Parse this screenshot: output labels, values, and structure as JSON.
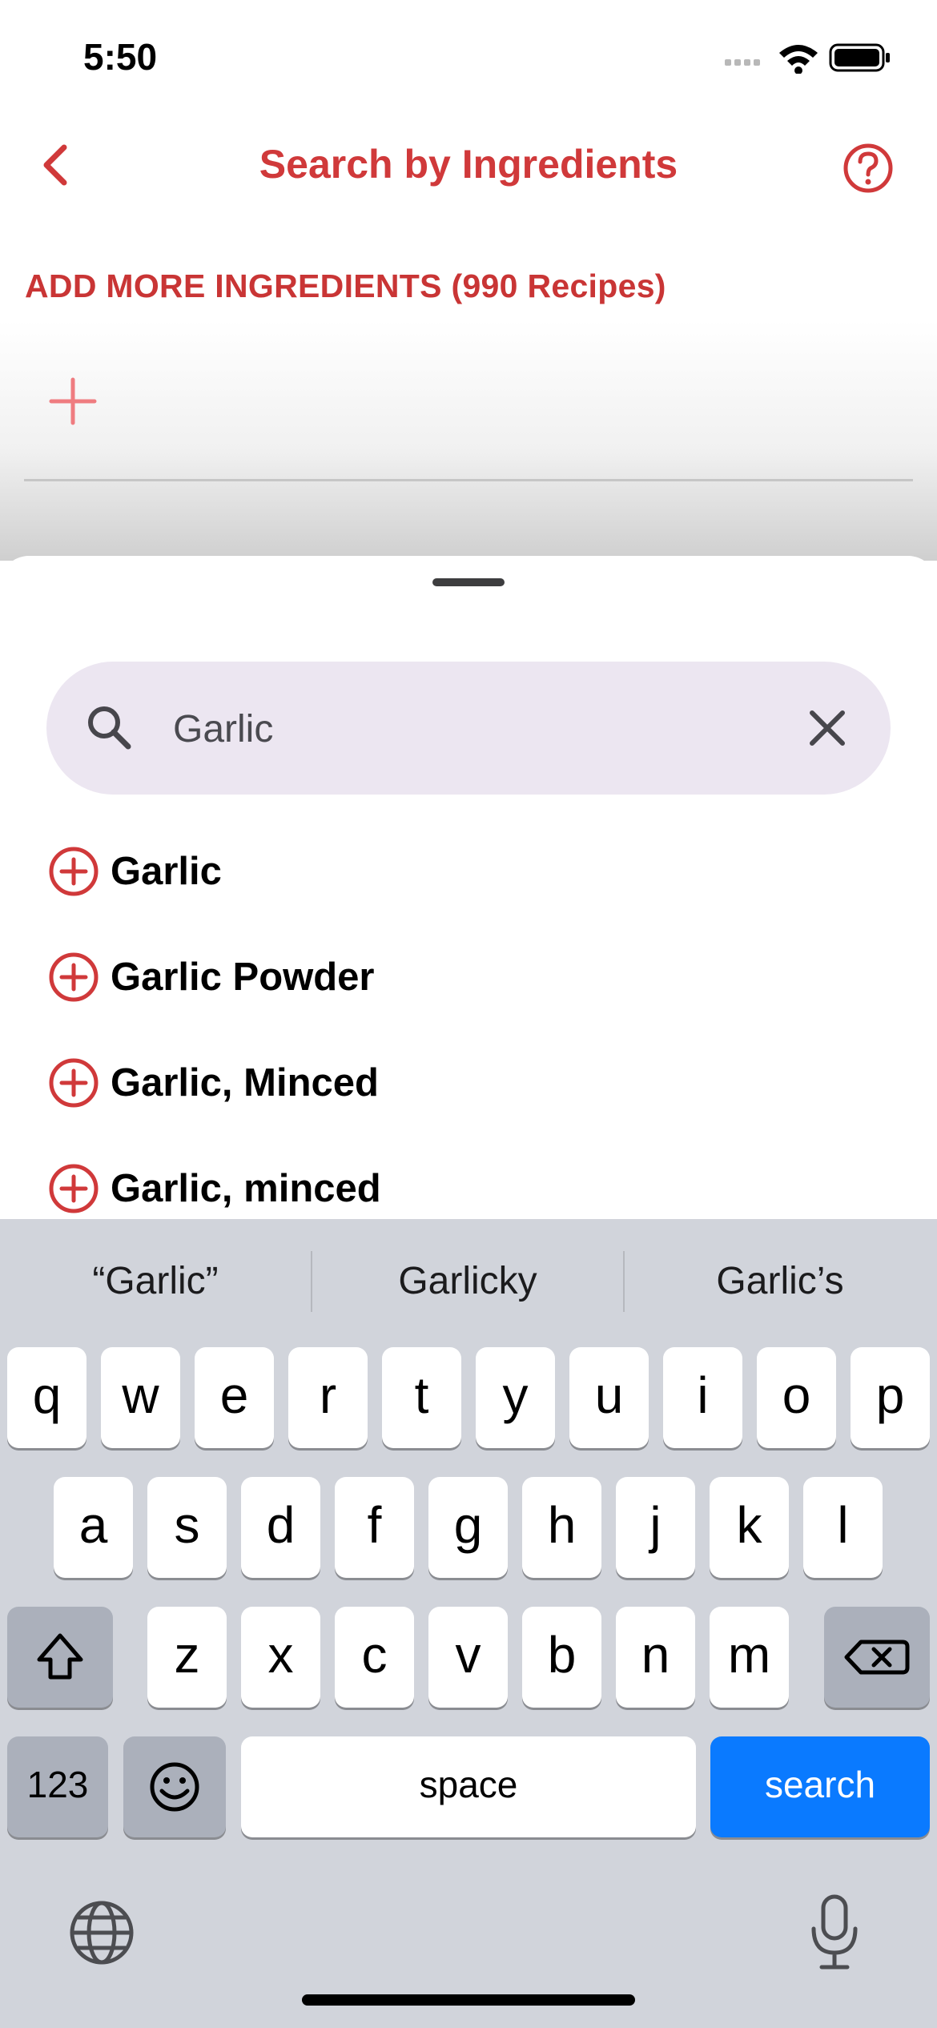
{
  "status_bar": {
    "time": "5:50"
  },
  "nav": {
    "title": "Search by Ingredients"
  },
  "section": {
    "label": "ADD MORE INGREDIENTS (990 Recipes)"
  },
  "search": {
    "value": "Garlic"
  },
  "results": [
    "Garlic",
    "Garlic Powder",
    "Garlic, Minced",
    "Garlic, minced"
  ],
  "keyboard": {
    "suggestions": [
      "“Garlic”",
      "Garlicky",
      "Garlic’s"
    ],
    "row1": [
      "q",
      "w",
      "e",
      "r",
      "t",
      "y",
      "u",
      "i",
      "o",
      "p"
    ],
    "row2": [
      "a",
      "s",
      "d",
      "f",
      "g",
      "h",
      "j",
      "k",
      "l"
    ],
    "row3": [
      "z",
      "x",
      "c",
      "v",
      "b",
      "n",
      "m"
    ],
    "numbers_label": "123",
    "space_label": "space",
    "action_label": "search"
  },
  "colors": {
    "accent": "#d0393a",
    "search_bg": "#ece6f1",
    "action_key": "#0a7aff"
  },
  "icons": [
    "back-chevron-icon",
    "help-icon",
    "plus-icon",
    "search-icon",
    "clear-icon",
    "add-circle-icon",
    "shift-icon",
    "delete-icon",
    "emoji-icon",
    "globe-icon",
    "microphone-icon"
  ]
}
